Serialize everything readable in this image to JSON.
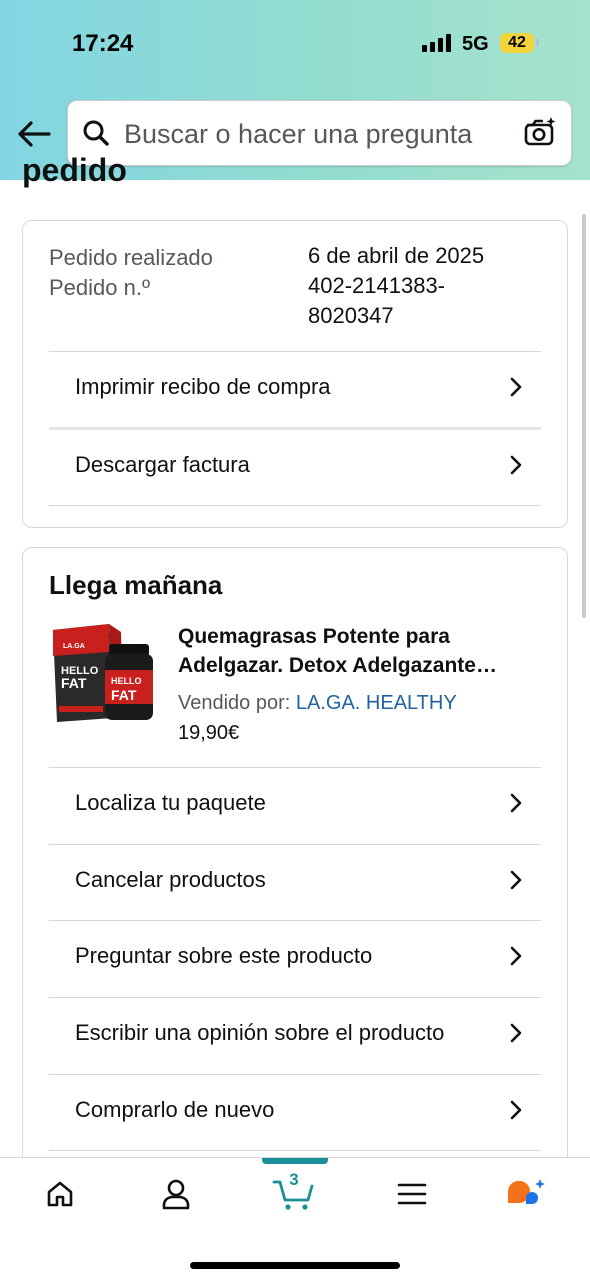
{
  "status_bar": {
    "time": "17:24",
    "network": "5G",
    "battery": "42"
  },
  "search": {
    "placeholder": "Buscar o hacer una pregunta"
  },
  "page": {
    "clipped_title": "pedido"
  },
  "order_info": {
    "placed_label": "Pedido realizado",
    "placed_value": "6 de abril de 2025",
    "number_label": "Pedido n.º",
    "number_value": "402-2141383-8020347",
    "actions": [
      {
        "label": "Imprimir recibo de compra"
      },
      {
        "label": "Descargar factura"
      }
    ]
  },
  "shipment": {
    "title": "Llega mañana",
    "product": {
      "title": "Quemagrasas Potente para Adelgazar. Detox Adelgazante Potente, Quemador de Grasa",
      "sold_by_label": "Vendido por:",
      "seller": "LA.GA. HEALTHY",
      "price": "19,90€",
      "image_text_brand": "LA.GA",
      "image_text_1": "HELLO",
      "image_text_2": "FAT"
    },
    "actions": [
      {
        "label": "Localiza tu paquete"
      },
      {
        "label": "Cancelar productos"
      },
      {
        "label": "Preguntar sobre este producto"
      },
      {
        "label": "Escribir una opinión sobre el producto"
      },
      {
        "label": "Comprarlo de nuevo"
      }
    ]
  },
  "bottom_nav": {
    "cart_count": "3",
    "items": [
      "home-icon",
      "account-icon",
      "cart-icon",
      "menu-icon",
      "rufus-icon"
    ]
  },
  "colors": {
    "accent": "#1a8f98",
    "link": "#2162a1",
    "header_gradient_start": "#82d6e3",
    "header_gradient_end": "#a6e3cd"
  }
}
